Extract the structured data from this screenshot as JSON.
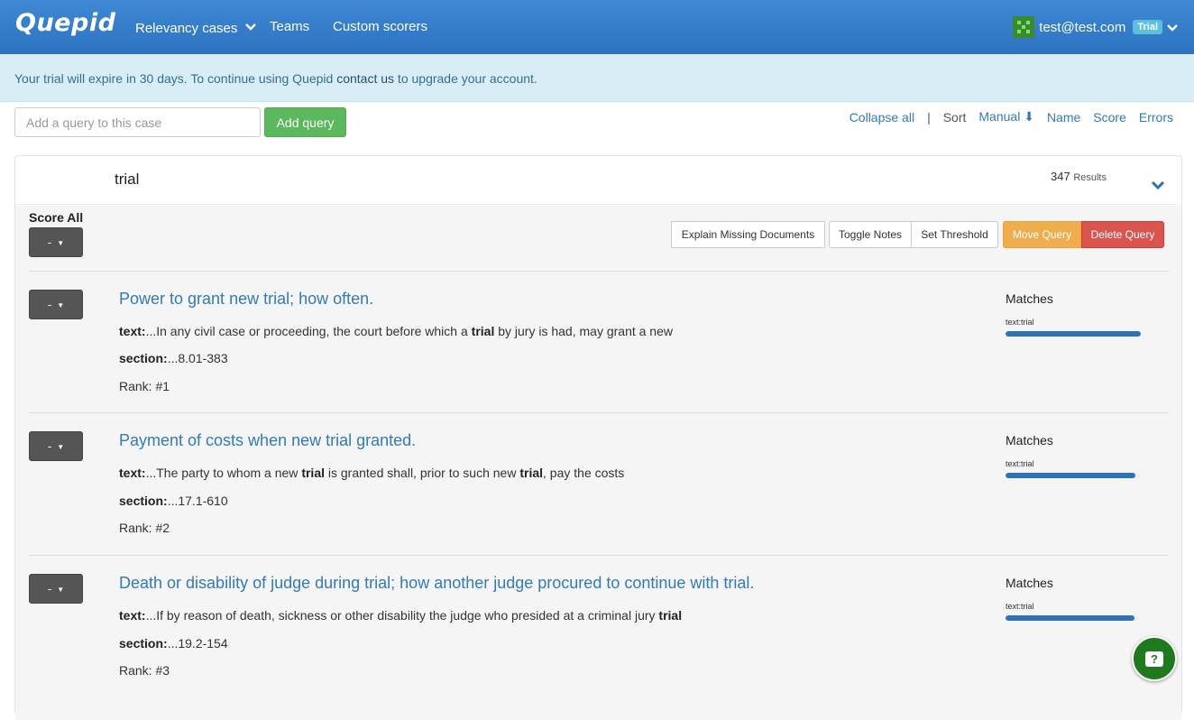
{
  "nav": {
    "brand": "Quepid",
    "links": [
      "Relevancy cases",
      "Teams",
      "Custom scorers"
    ],
    "user_email": "test@test.com",
    "user_badge": "Trial"
  },
  "alert": {
    "prefix": "Your trial will expire in 30 days. To continue using Quepid ",
    "link": "contact us",
    "suffix": " to upgrade your account."
  },
  "query_entry": {
    "placeholder": "Add a query to this case",
    "add_label": "Add query"
  },
  "sortbar": {
    "collapse": "Collapse all",
    "sep": "|",
    "sort": "Sort",
    "manual": "Manual",
    "arrow": "⬇",
    "name": "Name",
    "score": "Score",
    "errors": "Errors"
  },
  "query": {
    "text": "trial",
    "results_count": "347",
    "results_label": "Results",
    "score_all_label": "Score All",
    "score_placeholder": "-",
    "toolbar": {
      "explain": "Explain Missing Documents",
      "toggle_notes": "Toggle Notes",
      "set_threshold": "Set Threshold",
      "move": "Move Query",
      "delete": "Delete Query"
    }
  },
  "docs": [
    {
      "title": "Power to grant new trial; how often.",
      "text_label": "text:",
      "text_parts": [
        "...In any civil case or proceeding, the court before which a ",
        "trial",
        " by jury is had, may grant a new",
        "",
        ""
      ],
      "section_label": "section:",
      "section": "...8.01-383",
      "rank": "Rank: #1",
      "matches_label": "Matches",
      "match_field": "text:trial",
      "match_fill": 1.0
    },
    {
      "title": "Payment of costs when new trial granted.",
      "text_label": "text:",
      "text_parts": [
        "...The party to whom a new ",
        "trial",
        " is granted shall, prior to such new ",
        "trial",
        ", pay the costs"
      ],
      "section_label": "section:",
      "section": "...17.1-610",
      "rank": "Rank: #2",
      "matches_label": "Matches",
      "match_field": "text:trial",
      "match_fill": 0.96
    },
    {
      "title": "Death or disability of judge during trial; how another judge procured to continue with trial.",
      "text_label": "text:",
      "text_parts": [
        "...If by reason of death, sickness or other disability the judge who presided at a criminal jury ",
        "trial",
        "",
        "",
        ""
      ],
      "section_label": "section:",
      "section": "...19.2-154",
      "rank": "Rank: #3",
      "matches_label": "Matches",
      "match_field": "text:trial",
      "match_fill": 0.95
    }
  ],
  "help_icon": "question-chat-icon",
  "help_glyph": "?"
}
